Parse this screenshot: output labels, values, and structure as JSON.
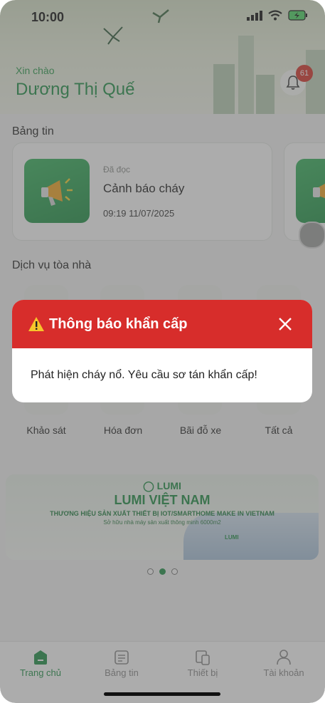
{
  "status_bar": {
    "time": "10:00"
  },
  "header": {
    "greeting": "Xin chào",
    "user_name": "Dương Thị Quế",
    "notification_count": "61"
  },
  "news": {
    "section_title": "Bảng tin",
    "card": {
      "status": "Đã đọc",
      "title": "Cảnh báo cháy",
      "time": "09:19 11/07/2025"
    }
  },
  "services": {
    "section_title": "Dịch vụ tòa nhà",
    "items": [
      {
        "label": "Khảo sát"
      },
      {
        "label": "Hóa đơn"
      },
      {
        "label": "Bãi đỗ xe"
      },
      {
        "label": "Tất cả"
      }
    ]
  },
  "banner": {
    "logo": "LUMI",
    "title": "LUMI VIỆT NAM",
    "subtitle": "THƯƠNG HIỆU SẢN XUẤT THIẾT BỊ IOT/SMARTHOME MAKE IN VIETNAM",
    "tagline": "Sở hữu nhà máy sản xuất thông minh 6000m2",
    "building_sign": "LUMI",
    "carousel_active_index": 1
  },
  "tabbar": {
    "items": [
      {
        "label": "Trang chủ",
        "active": true
      },
      {
        "label": "Bảng tin",
        "active": false
      },
      {
        "label": "Thiết bị",
        "active": false
      },
      {
        "label": "Tài khoản",
        "active": false
      }
    ]
  },
  "dialog": {
    "title": "Thông báo khẩn cấp",
    "message": "Phát hiện cháy nổ. Yêu cầu sơ tán khẩn cấp!"
  },
  "colors": {
    "brand_green": "#1f9146",
    "alert_red": "#d72d2b",
    "badge_red": "#d9342b"
  }
}
